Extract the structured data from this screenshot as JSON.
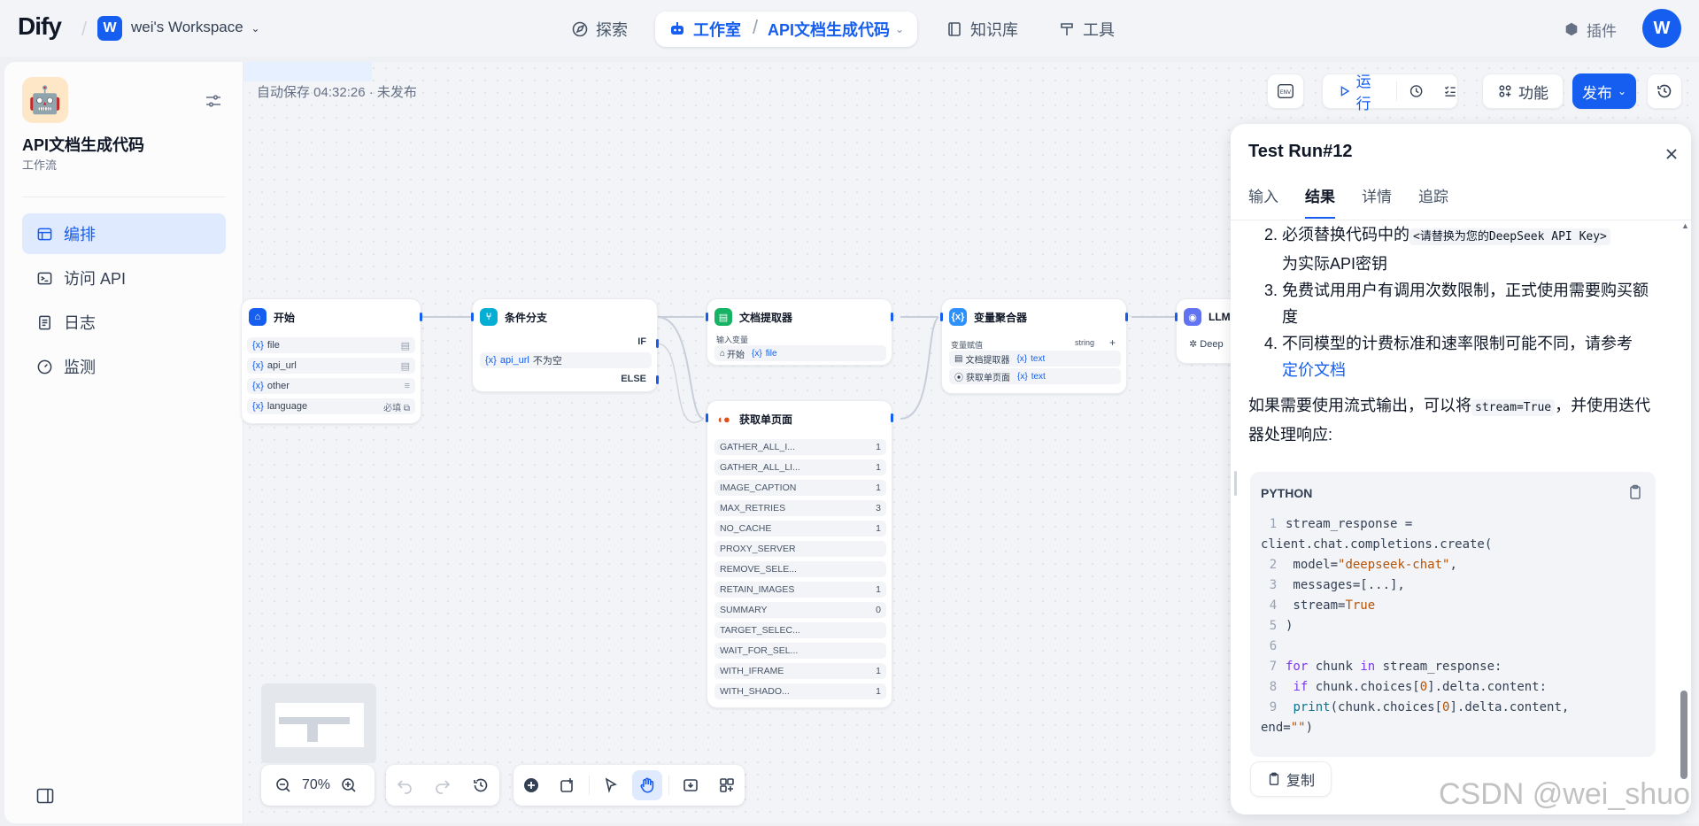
{
  "header": {
    "logo": "Dify",
    "workspace_initial": "W",
    "workspace_name": "wei's Workspace",
    "nav_explore": "探索",
    "nav_studio": "工作室",
    "nav_app": "API文档生成代码",
    "nav_knowledge": "知识库",
    "nav_tools": "工具",
    "plugins": "插件",
    "user_initial": "W"
  },
  "sidebar": {
    "app_name": "API文档生成代码",
    "app_type": "工作流",
    "items": [
      {
        "label": "编排"
      },
      {
        "label": "访问 API"
      },
      {
        "label": "日志"
      },
      {
        "label": "监测"
      }
    ]
  },
  "toolbar": {
    "autosave": "自动保存 04:32:26 · 未发布",
    "env": "ENV",
    "run": "运行",
    "features": "功能",
    "publish": "发布"
  },
  "nodes": {
    "start": {
      "title": "开始",
      "vars": [
        {
          "name": "file",
          "tag": ""
        },
        {
          "name": "api_url",
          "tag": ""
        },
        {
          "name": "other",
          "tag": ""
        },
        {
          "name": "language",
          "tag": "必填"
        }
      ]
    },
    "ifelse": {
      "title": "条件分支",
      "if_label": "IF",
      "else_label": "ELSE",
      "cond_var": "api_url",
      "cond_op": "不为空"
    },
    "doc": {
      "title": "文档提取器",
      "input_label": "输入变量",
      "input_src": "开始",
      "input_var": "file"
    },
    "agg": {
      "title": "变量聚合器",
      "label": "变量赋值",
      "type": "string",
      "rows": [
        {
          "src": "文档提取器",
          "var": "text"
        },
        {
          "src": "获取单页面",
          "var": "text"
        }
      ]
    },
    "llm": {
      "title": "LLM",
      "model": "Deep"
    },
    "fetch": {
      "title": "获取单页面",
      "params": [
        {
          "name": "GATHER_ALL_I...",
          "value": "1"
        },
        {
          "name": "GATHER_ALL_LI...",
          "value": "1"
        },
        {
          "name": "IMAGE_CAPTION",
          "value": "1"
        },
        {
          "name": "MAX_RETRIES",
          "value": "3"
        },
        {
          "name": "NO_CACHE",
          "value": "1"
        },
        {
          "name": "PROXY_SERVER",
          "value": ""
        },
        {
          "name": "REMOVE_SELE...",
          "value": ""
        },
        {
          "name": "RETAIN_IMAGES",
          "value": "1"
        },
        {
          "name": "SUMMARY",
          "value": "0"
        },
        {
          "name": "TARGET_SELEC...",
          "value": ""
        },
        {
          "name": "WAIT_FOR_SEL...",
          "value": ""
        },
        {
          "name": "WITH_IFRAME",
          "value": "1"
        },
        {
          "name": "WITH_SHADO...",
          "value": "1"
        }
      ]
    }
  },
  "bottom": {
    "zoom": "70%"
  },
  "panel": {
    "title": "Test Run#12",
    "tabs": [
      "输入",
      "结果",
      "详情",
      "追踪"
    ],
    "active_tab": "结果",
    "li2_a": "必须替换代码中的",
    "li2_code": "<请替换为您的DeepSeek API Key>",
    "li2_b": "为实际API密钥",
    "li3": "免费试用用户有调用次数限制，正式使用需要购买额度",
    "li4": "不同模型的计费标准和速率限制可能不同，请参考",
    "li4_link": "定价文档",
    "para_a": "如果需要使用流式输出，可以将",
    "para_code": "stream=True",
    "para_b": "，并使用迭代器处理响应:",
    "code_lang": "PYTHON",
    "copy": "复制"
  },
  "watermark": "CSDN @wei_shuo",
  "colors": {
    "accent": "#155eef",
    "background": "#f2f4f7"
  }
}
